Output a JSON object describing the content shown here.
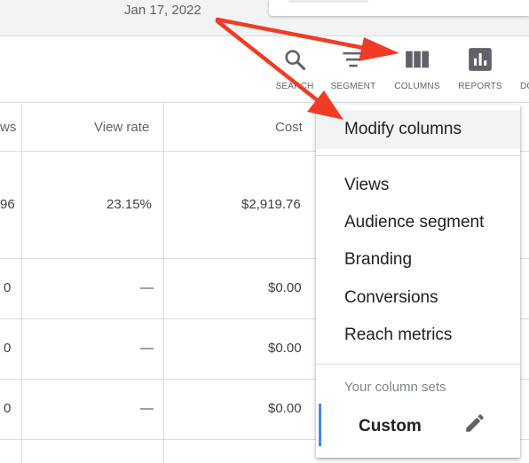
{
  "header": {
    "date": "Jan 17, 2022"
  },
  "toolbar": {
    "search_label": "SEARCH",
    "segment_label": "SEGMENT",
    "columns_label": "COLUMNS",
    "reports_label": "REPORTS",
    "more_label": "DO"
  },
  "table": {
    "headers": {
      "first": "ws",
      "view_rate": "View rate",
      "cost": "Cost"
    },
    "rows": [
      {
        "first": "96",
        "view_rate": "23.15%",
        "cost": "$2,919.76"
      },
      {
        "first": "0",
        "view_rate": "—",
        "cost": "$0.00"
      },
      {
        "first": "0",
        "view_rate": "—",
        "cost": "$0.00"
      },
      {
        "first": "0",
        "view_rate": "—",
        "cost": "$0.00"
      }
    ]
  },
  "menu": {
    "modify": "Modify columns",
    "items": [
      "Views",
      "Audience segment",
      "Branding",
      "Conversions",
      "Reach metrics"
    ],
    "sets_label": "Your column sets",
    "custom": "Custom"
  },
  "colors": {
    "arrow": "#f03c24",
    "accent": "#4285f4"
  }
}
